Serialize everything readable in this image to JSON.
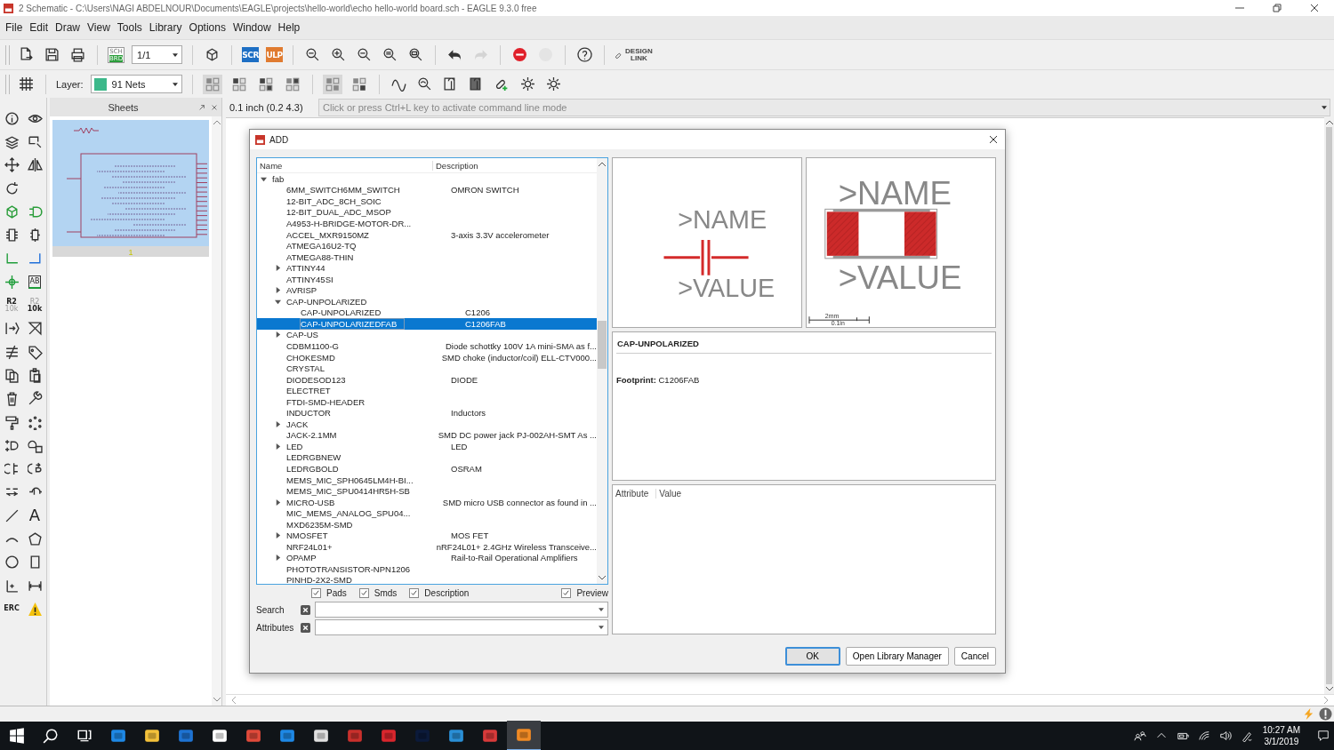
{
  "window": {
    "title": "2 Schematic - C:\\Users\\NAGI ABDELNOUR\\Documents\\EAGLE\\projects\\hello-world\\echo hello-world board.sch - EAGLE 9.3.0 free"
  },
  "menu": [
    "File",
    "Edit",
    "Draw",
    "View",
    "Tools",
    "Library",
    "Options",
    "Window",
    "Help"
  ],
  "toolbar": {
    "sch": "SCH",
    "brd": "BRD",
    "sheet": "1/1",
    "scr": "SCR",
    "ulp": "ULP",
    "design": "DESIGN",
    "link": "LINK"
  },
  "layer_bar": {
    "label": "Layer:",
    "layer": "91 Nets"
  },
  "tool_texts": {
    "label": "AB",
    "name_ref": "R2",
    "name_val": "10k",
    "value_ref": "R2",
    "value_val": "10k",
    "text": "A",
    "erc": "ERC"
  },
  "sheets": {
    "title": "Sheets",
    "page": "1"
  },
  "grid_info": "0.1 inch (0.2 4.3)",
  "command": {
    "placeholder": "Click or press Ctrl+L key to activate command line mode"
  },
  "dialog": {
    "title": "ADD",
    "columns": [
      "Name",
      "Description"
    ],
    "rows": [
      {
        "name": "fab",
        "expanded": true,
        "selected": false,
        "children": [
          {
            "name": "6MM_SWITCH6MM_SWITCH",
            "description": "OMRON SWITCH",
            "selected": false
          },
          {
            "name": "12-BIT_ADC_8CH_SOIC",
            "selected": false
          },
          {
            "name": "12-BIT_DUAL_ADC_MSOP",
            "selected": false
          },
          {
            "name": "A4953-H-BRIDGE-MOTOR-DR...",
            "selected": false
          },
          {
            "name": "ACCEL_MXR9150MZ",
            "description": "3-axis 3.3V accelerometer",
            "selected": false
          },
          {
            "name": "ATMEGA16U2-TQ",
            "selected": false
          },
          {
            "name": "ATMEGA88-THIN",
            "selected": false
          },
          {
            "name": "ATTINY44",
            "expanded": false,
            "selected": false
          },
          {
            "name": "ATTINY45SI",
            "selected": false
          },
          {
            "name": "AVRISP",
            "expanded": false,
            "selected": false
          },
          {
            "name": "CAP-UNPOLARIZED",
            "expanded": true,
            "selected": false,
            "children": [
              {
                "name": "CAP-UNPOLARIZED",
                "description": "C1206",
                "selected": false
              },
              {
                "name": "CAP-UNPOLARIZEDFAB",
                "description": "C1206FAB",
                "selected": true
              }
            ]
          },
          {
            "name": "CAP-US",
            "expanded": false,
            "selected": false
          },
          {
            "name": "CDBM1100-G",
            "description": "Diode schottky 100V 1A mini-SMA as f...",
            "selected": false
          },
          {
            "name": "CHOKESMD",
            "description": "SMD choke (inductor/coil) ELL-CTV000...",
            "selected": false
          },
          {
            "name": "CRYSTAL",
            "selected": false
          },
          {
            "name": "DIODESOD123",
            "description": "DIODE",
            "selected": false
          },
          {
            "name": "ELECTRET",
            "selected": false
          },
          {
            "name": "FTDI-SMD-HEADER",
            "selected": false
          },
          {
            "name": "INDUCTOR",
            "description": "Inductors",
            "selected": false
          },
          {
            "name": "JACK",
            "expanded": false,
            "selected": false
          },
          {
            "name": "JACK-2.1MM",
            "description": "SMD DC power jack PJ-002AH-SMT As ...",
            "selected": false
          },
          {
            "name": "LED",
            "description": "LED",
            "expanded": false,
            "selected": false
          },
          {
            "name": "LEDRGBNEW",
            "selected": false
          },
          {
            "name": "LEDRGBOLD",
            "description": "OSRAM",
            "selected": false
          },
          {
            "name": "MEMS_MIC_SPH0645LM4H-BI...",
            "selected": false
          },
          {
            "name": "MEMS_MIC_SPU0414HR5H-SB",
            "selected": false
          },
          {
            "name": "MICRO-USB",
            "description": "SMD micro USB connector as found in ...",
            "expanded": false,
            "selected": false
          },
          {
            "name": "MIC_MEMS_ANALOG_SPU04...",
            "selected": false
          },
          {
            "name": "MXD6235M-SMD",
            "selected": false
          },
          {
            "name": "NMOSFET",
            "description": "MOS FET",
            "expanded": false,
            "selected": false
          },
          {
            "name": "NRF24L01+",
            "description": "nRF24L01+ 2.4GHz Wireless Transceive...",
            "selected": false
          },
          {
            "name": "OPAMP",
            "description": "Rail-to-Rail Operational Amplifiers",
            "expanded": false,
            "selected": false
          },
          {
            "name": "PHOTOTRANSISTOR-NPN1206",
            "selected": false
          },
          {
            "name": "PINHD-2X2-SMD",
            "selected": false
          }
        ]
      }
    ],
    "filters": [
      {
        "label": "Pads",
        "checked": true
      },
      {
        "label": "Smds",
        "checked": true
      },
      {
        "label": "Description",
        "checked": true
      }
    ],
    "preview": {
      "label": "Preview",
      "checked": true
    },
    "search": {
      "label": "Search"
    },
    "attributes": {
      "label": "Attributes"
    },
    "symbol": {
      "name": ">NAME",
      "value": ">VALUE"
    },
    "package": {
      "name": ">NAME",
      "value": ">VALUE",
      "scale_mm": "2mm",
      "scale_in": "0.1in"
    },
    "info": {
      "heading": "CAP-UNPOLARIZED",
      "footprint": "**Footprint:** C1206FAB"
    },
    "attr_columns": [
      "Attribute",
      "Value"
    ],
    "buttons": [
      "OK",
      "Open Library Manager",
      "Cancel"
    ]
  },
  "clock": {
    "time": "10:27 AM",
    "date": "3/1/2019"
  }
}
